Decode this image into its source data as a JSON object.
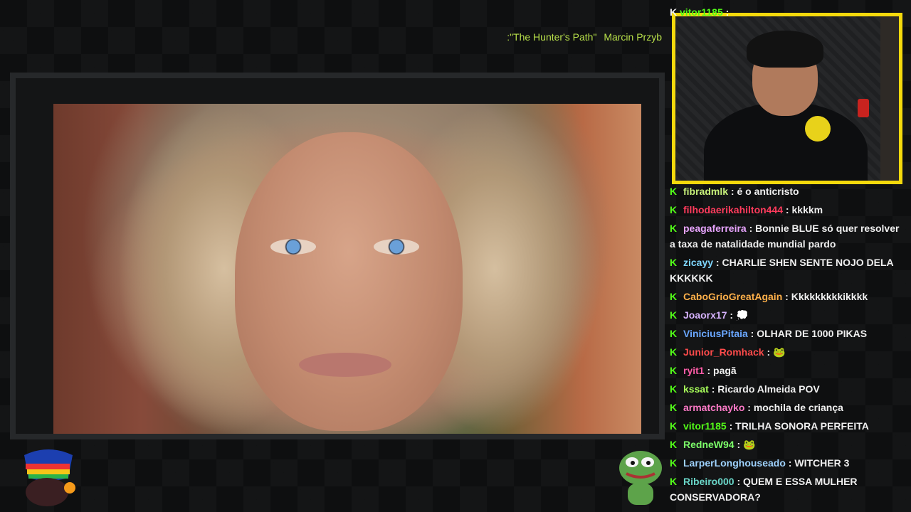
{
  "now_playing": {
    "title": ":\"The Hunter's Path\"",
    "artist": "Marcin Przyb"
  },
  "chat": {
    "top_message": {
      "user": "vitor1185",
      "color": "#53fc18"
    },
    "messages": [
      {
        "user": "fibradmlk",
        "color": "#c7f07a",
        "text": "é o anticristo"
      },
      {
        "user": "filhodaerikahilton444",
        "color": "#ff3b5c",
        "text": "kkkkm"
      },
      {
        "user": "peagaferreira",
        "color": "#e9a5ff",
        "text": "Bonnie BLUE só quer resolver a taxa de natalidade mundial pardo"
      },
      {
        "user": "zicayy",
        "color": "#7fd7ff",
        "text": "CHARLIE SHEN SENTE NOJO DELA KKKKKK"
      },
      {
        "user": "CaboGrioGreatAgain",
        "color": "#ffb04a",
        "text": "Kkkkkkkkkikkkk"
      },
      {
        "user": "Joaorx17",
        "color": "#d7b3ff",
        "text": "",
        "emote": "speech-bubble-emote"
      },
      {
        "user": "ViniciusPitaia",
        "color": "#6aa7ff",
        "text": "OLHAR DE 1000 PIKAS"
      },
      {
        "user": "Junior_Romhack",
        "color": "#ff4b4b",
        "text": "",
        "emote": "pepe-emote"
      },
      {
        "user": "ryit1",
        "color": "#ff5ca8",
        "text": "pagã"
      },
      {
        "user": "kssat",
        "color": "#a8ff5a",
        "text": "Ricardo Almeida POV"
      },
      {
        "user": "armatchayko",
        "color": "#ff7ac8",
        "text": "mochila de criança"
      },
      {
        "user": "vitor1185",
        "color": "#53fc18",
        "text": "TRILHA SONORA PERFEITA"
      },
      {
        "user": "RedneW94",
        "color": "#7dff6a",
        "text": "",
        "emote": "pepe-emote"
      },
      {
        "user": "LarperLonghouseado",
        "color": "#9fd3ff",
        "text": "WITCHER 3"
      },
      {
        "user": "Ribeiro000",
        "color": "#6ad6c8",
        "text": "QUEM E ESSA MULHER CONSERVADORA?"
      }
    ]
  },
  "colors": {
    "cam_border": "#f5d90c",
    "kick_green": "#53fc18",
    "now_playing": "#b8e04a"
  }
}
